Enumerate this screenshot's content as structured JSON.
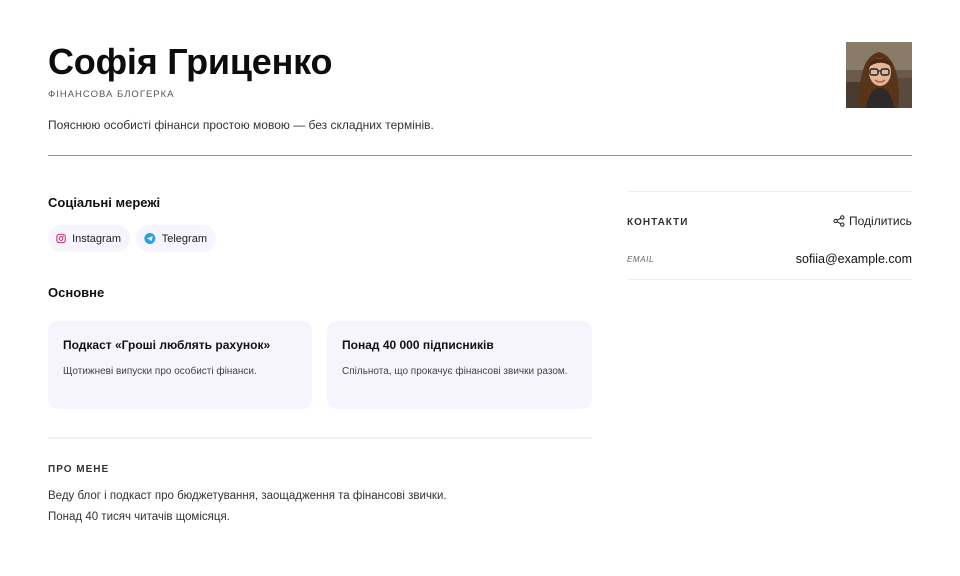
{
  "profile": {
    "name": "Софія Гриценко",
    "role": "ФІНАНСОВА БЛОГЕРКА",
    "tagline": "Пояснюю особисті фінанси простою мовою — без складних термінів.",
    "avatar_icon": "profile-photo"
  },
  "social": {
    "title": "Соціальні мережі",
    "links": [
      {
        "label": "Instagram",
        "icon": "instagram-icon",
        "color": "#c2185b"
      },
      {
        "label": "Telegram",
        "icon": "telegram-icon",
        "color": "#2aa0dc"
      }
    ]
  },
  "main": {
    "title": "Основне",
    "cards": [
      {
        "title": "Подкаст «Гроші люблять рахунок»",
        "text": "Щотижневі випуски про особисті фінанси."
      },
      {
        "title": "Понад 40 000 підписників",
        "text": "Спільнота, що прокачує фінансові звички разом."
      }
    ]
  },
  "about": {
    "title": "ПРО МЕНЕ",
    "lines": [
      "Веду блог і подкаст про бюджетування, заощадження та фінансові звички.",
      "Понад 40 тисяч читачів щомісяця."
    ]
  },
  "contacts": {
    "title": "КОНТАКТИ",
    "share_label": "Поділитись",
    "share_icon": "share-icon",
    "email_label": "EMAIL",
    "email": "sofiia@example.com"
  },
  "colors": {
    "accent_surface": "#f6f4fd",
    "header_rule": "#a88a93"
  }
}
